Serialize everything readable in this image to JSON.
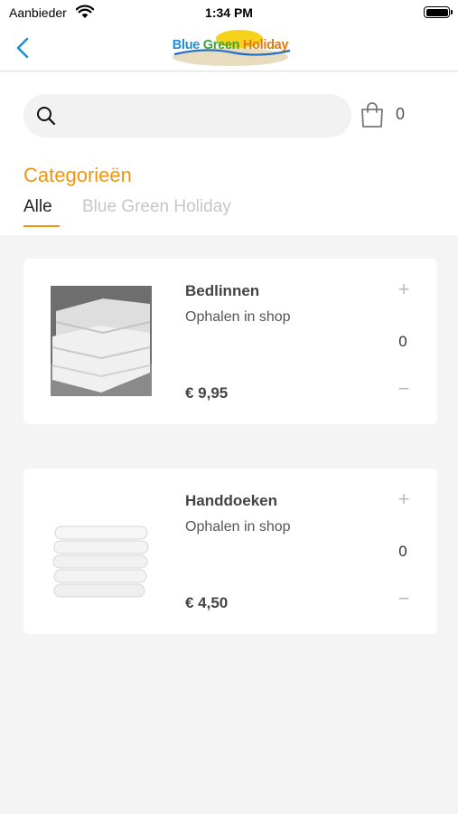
{
  "status_bar": {
    "carrier": "Aanbieder",
    "time": "1:34 PM"
  },
  "header": {
    "logo": {
      "word1": "Blue",
      "word2": "Green",
      "word3": "Holiday"
    },
    "back_icon": "chevron-left-icon"
  },
  "search": {
    "placeholder": "",
    "value": ""
  },
  "cart": {
    "count": "0",
    "icon": "shopping-bag-icon"
  },
  "categories": {
    "title": "Categorieën",
    "tabs": [
      {
        "label": "Alle",
        "active": true
      },
      {
        "label": "Blue Green Holiday",
        "active": false
      }
    ]
  },
  "products": [
    {
      "name": "Bedlinnen",
      "delivery": "Ophalen in shop",
      "quantity": "0",
      "price": "€ 9,95",
      "plus": "+",
      "minus": "−"
    },
    {
      "name": "Handdoeken",
      "delivery": "Ophalen in shop",
      "quantity": "0",
      "price": "€ 4,50",
      "plus": "+",
      "minus": "−"
    }
  ],
  "colors": {
    "accent": "#f0960e",
    "back_blue": "#1f8fd6",
    "background": "#f4f4f4"
  }
}
